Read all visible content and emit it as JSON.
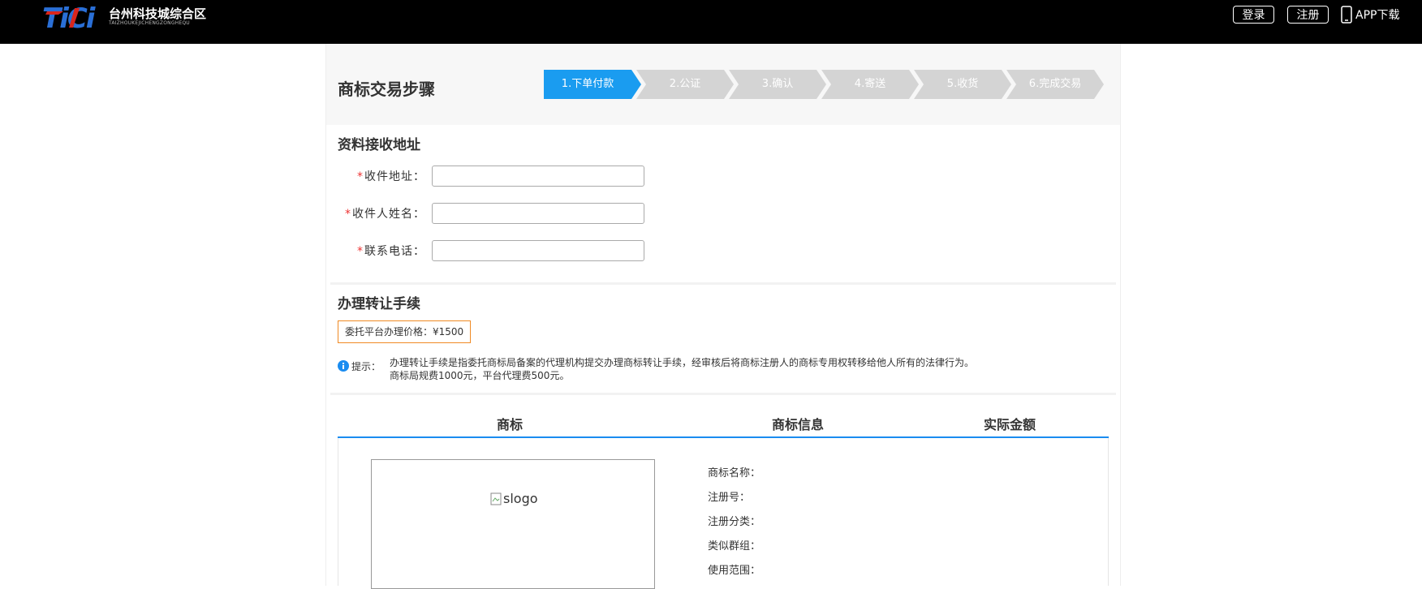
{
  "header": {
    "logo_cn": "台州科技城综合区",
    "logo_en": "TAIZHOUKEJICHENGZONGHEQU",
    "logo_mark": "TiCi",
    "login_label": "登录",
    "register_label": "注册",
    "app_label": "APP下载",
    "colors": {
      "background": "#000000",
      "logo_blue": "#2a6fd6",
      "logo_red": "#d9251c"
    }
  },
  "steps": {
    "title": "商标交易步骤",
    "items": [
      {
        "label": "1.下单付款",
        "active": true
      },
      {
        "label": "2.公证",
        "active": false
      },
      {
        "label": "3.确认",
        "active": false
      },
      {
        "label": "4.寄送",
        "active": false
      },
      {
        "label": "5.收货",
        "active": false
      },
      {
        "label": "6.完成交易",
        "active": false
      }
    ],
    "active_color": "#1a9cf0",
    "inactive_color": "#d4d4d4"
  },
  "address": {
    "title": "资料接收地址",
    "fields": [
      {
        "required_mark": "*",
        "label": "收件地址：",
        "value": ""
      },
      {
        "required_mark": "*",
        "label": "收件人姓名：",
        "value": ""
      },
      {
        "required_mark": "*",
        "label": "联系电话：",
        "value": ""
      }
    ]
  },
  "transfer": {
    "title": "办理转让手续",
    "price_label": "委托平台办理价格：¥1500",
    "tip_prefix": "提示：",
    "tip_line1": "办理转让手续是指委托商标局备案的代理机构提交办理商标转让手续，经审核后将商标注册人的商标专用权转移给他人所有的法律行为。",
    "tip_line2": "商标局规费1000元，平台代理费500元。",
    "tip_icon": "info-icon",
    "price_border_color": "#f08a24"
  },
  "table": {
    "col_trademark": "商标",
    "col_info": "商标信息",
    "col_amount": "实际金额",
    "image_alt": "slogo",
    "info_fields": [
      "商标名称：",
      "注册号：",
      "注册分类：",
      "类似群组：",
      "使用范围："
    ],
    "header_line_color": "#1a8cf0"
  }
}
